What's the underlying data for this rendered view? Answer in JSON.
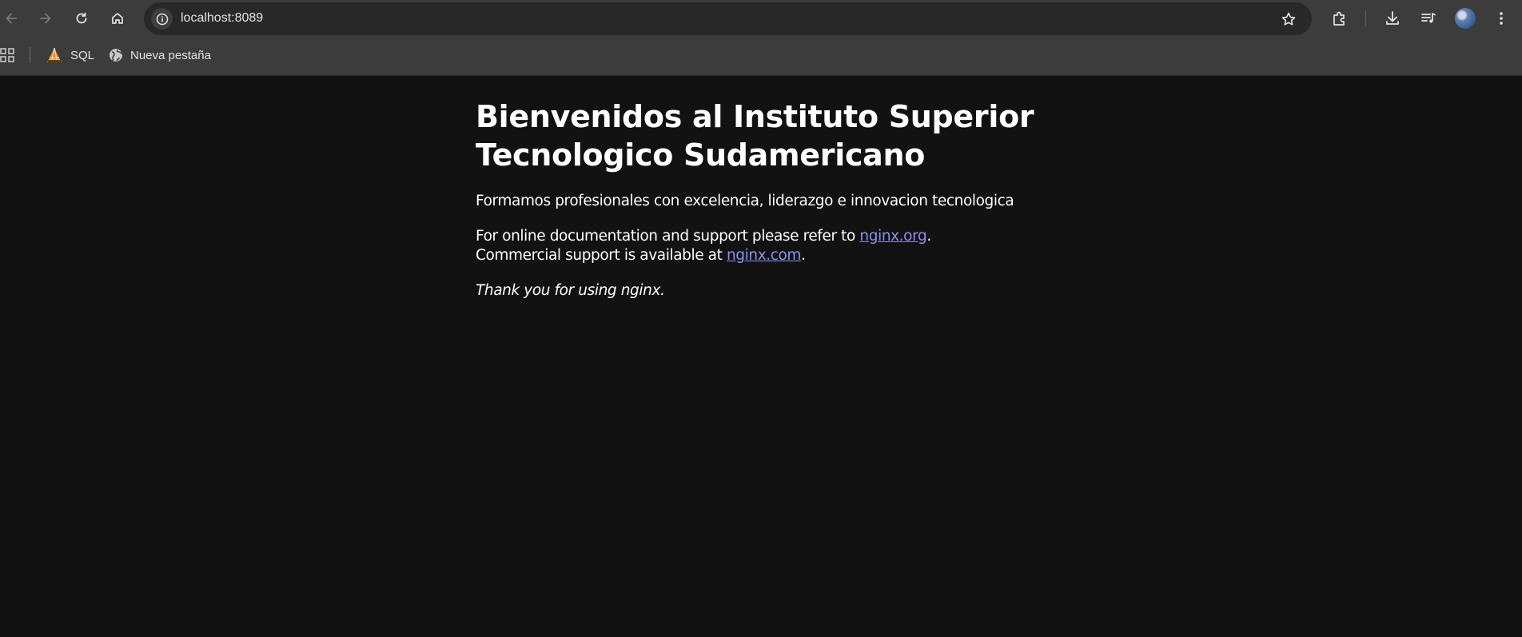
{
  "browser": {
    "url": "localhost:8089",
    "bookmarks": [
      {
        "label": "SQL",
        "icon": "sql-developer-icon"
      },
      {
        "label": "Nueva pestaña",
        "icon": "globe-icon"
      }
    ]
  },
  "page": {
    "heading": "Bienvenidos al Instituto Superior Tecnologico Sudamericano",
    "tagline": "Formamos profesionales con excelencia, liderazgo e innovacion tecnologica",
    "doc_text_before": "For online documentation and support please refer to",
    "doc_link": "nginx.org",
    "commercial_text_before": "Commercial support is available at",
    "commercial_link": "nginx.com",
    "thanks": "Thank you for using nginx.",
    "link_color": "#8e8ef0",
    "background": "#121212"
  }
}
